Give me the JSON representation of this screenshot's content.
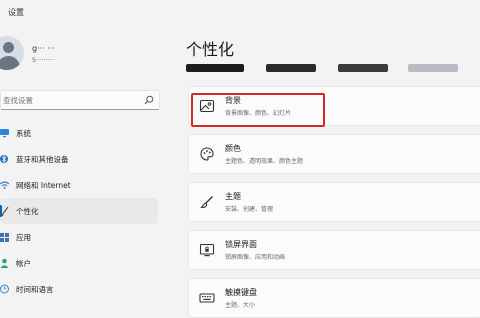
{
  "window": {
    "title": "设置"
  },
  "profile": {
    "name": "g··· ···",
    "email": "S··········"
  },
  "search": {
    "placeholder": "查找设置"
  },
  "nav": {
    "items": [
      {
        "label": "系统",
        "icon": "monitor-icon"
      },
      {
        "label": "蓝牙和其他设备",
        "icon": "bluetooth-icon"
      },
      {
        "label": "网络和 Internet",
        "icon": "wifi-icon"
      },
      {
        "label": "个性化",
        "icon": "brush-icon",
        "active": true
      },
      {
        "label": "应用",
        "icon": "apps-icon"
      },
      {
        "label": "帐户",
        "icon": "person-icon"
      },
      {
        "label": "时间和语言",
        "icon": "globe-clock-icon"
      }
    ]
  },
  "page": {
    "title": "个性化"
  },
  "cards": [
    {
      "title": "背景",
      "subtitle": "背景图像、颜色、幻灯片",
      "icon": "image-icon"
    },
    {
      "title": "颜色",
      "subtitle": "主题色、透明效果、颜色主题",
      "icon": "palette-icon"
    },
    {
      "title": "主题",
      "subtitle": "安装、创建、管理",
      "icon": "brush-icon"
    },
    {
      "title": "锁屏界面",
      "subtitle": "锁屏图像、应用和动画",
      "icon": "lock-screen-icon"
    },
    {
      "title": "触摸键盘",
      "subtitle": "主题、大小",
      "icon": "keyboard-icon"
    }
  ],
  "colors": {
    "accent": "#0067c0",
    "highlight": "#d62828"
  }
}
